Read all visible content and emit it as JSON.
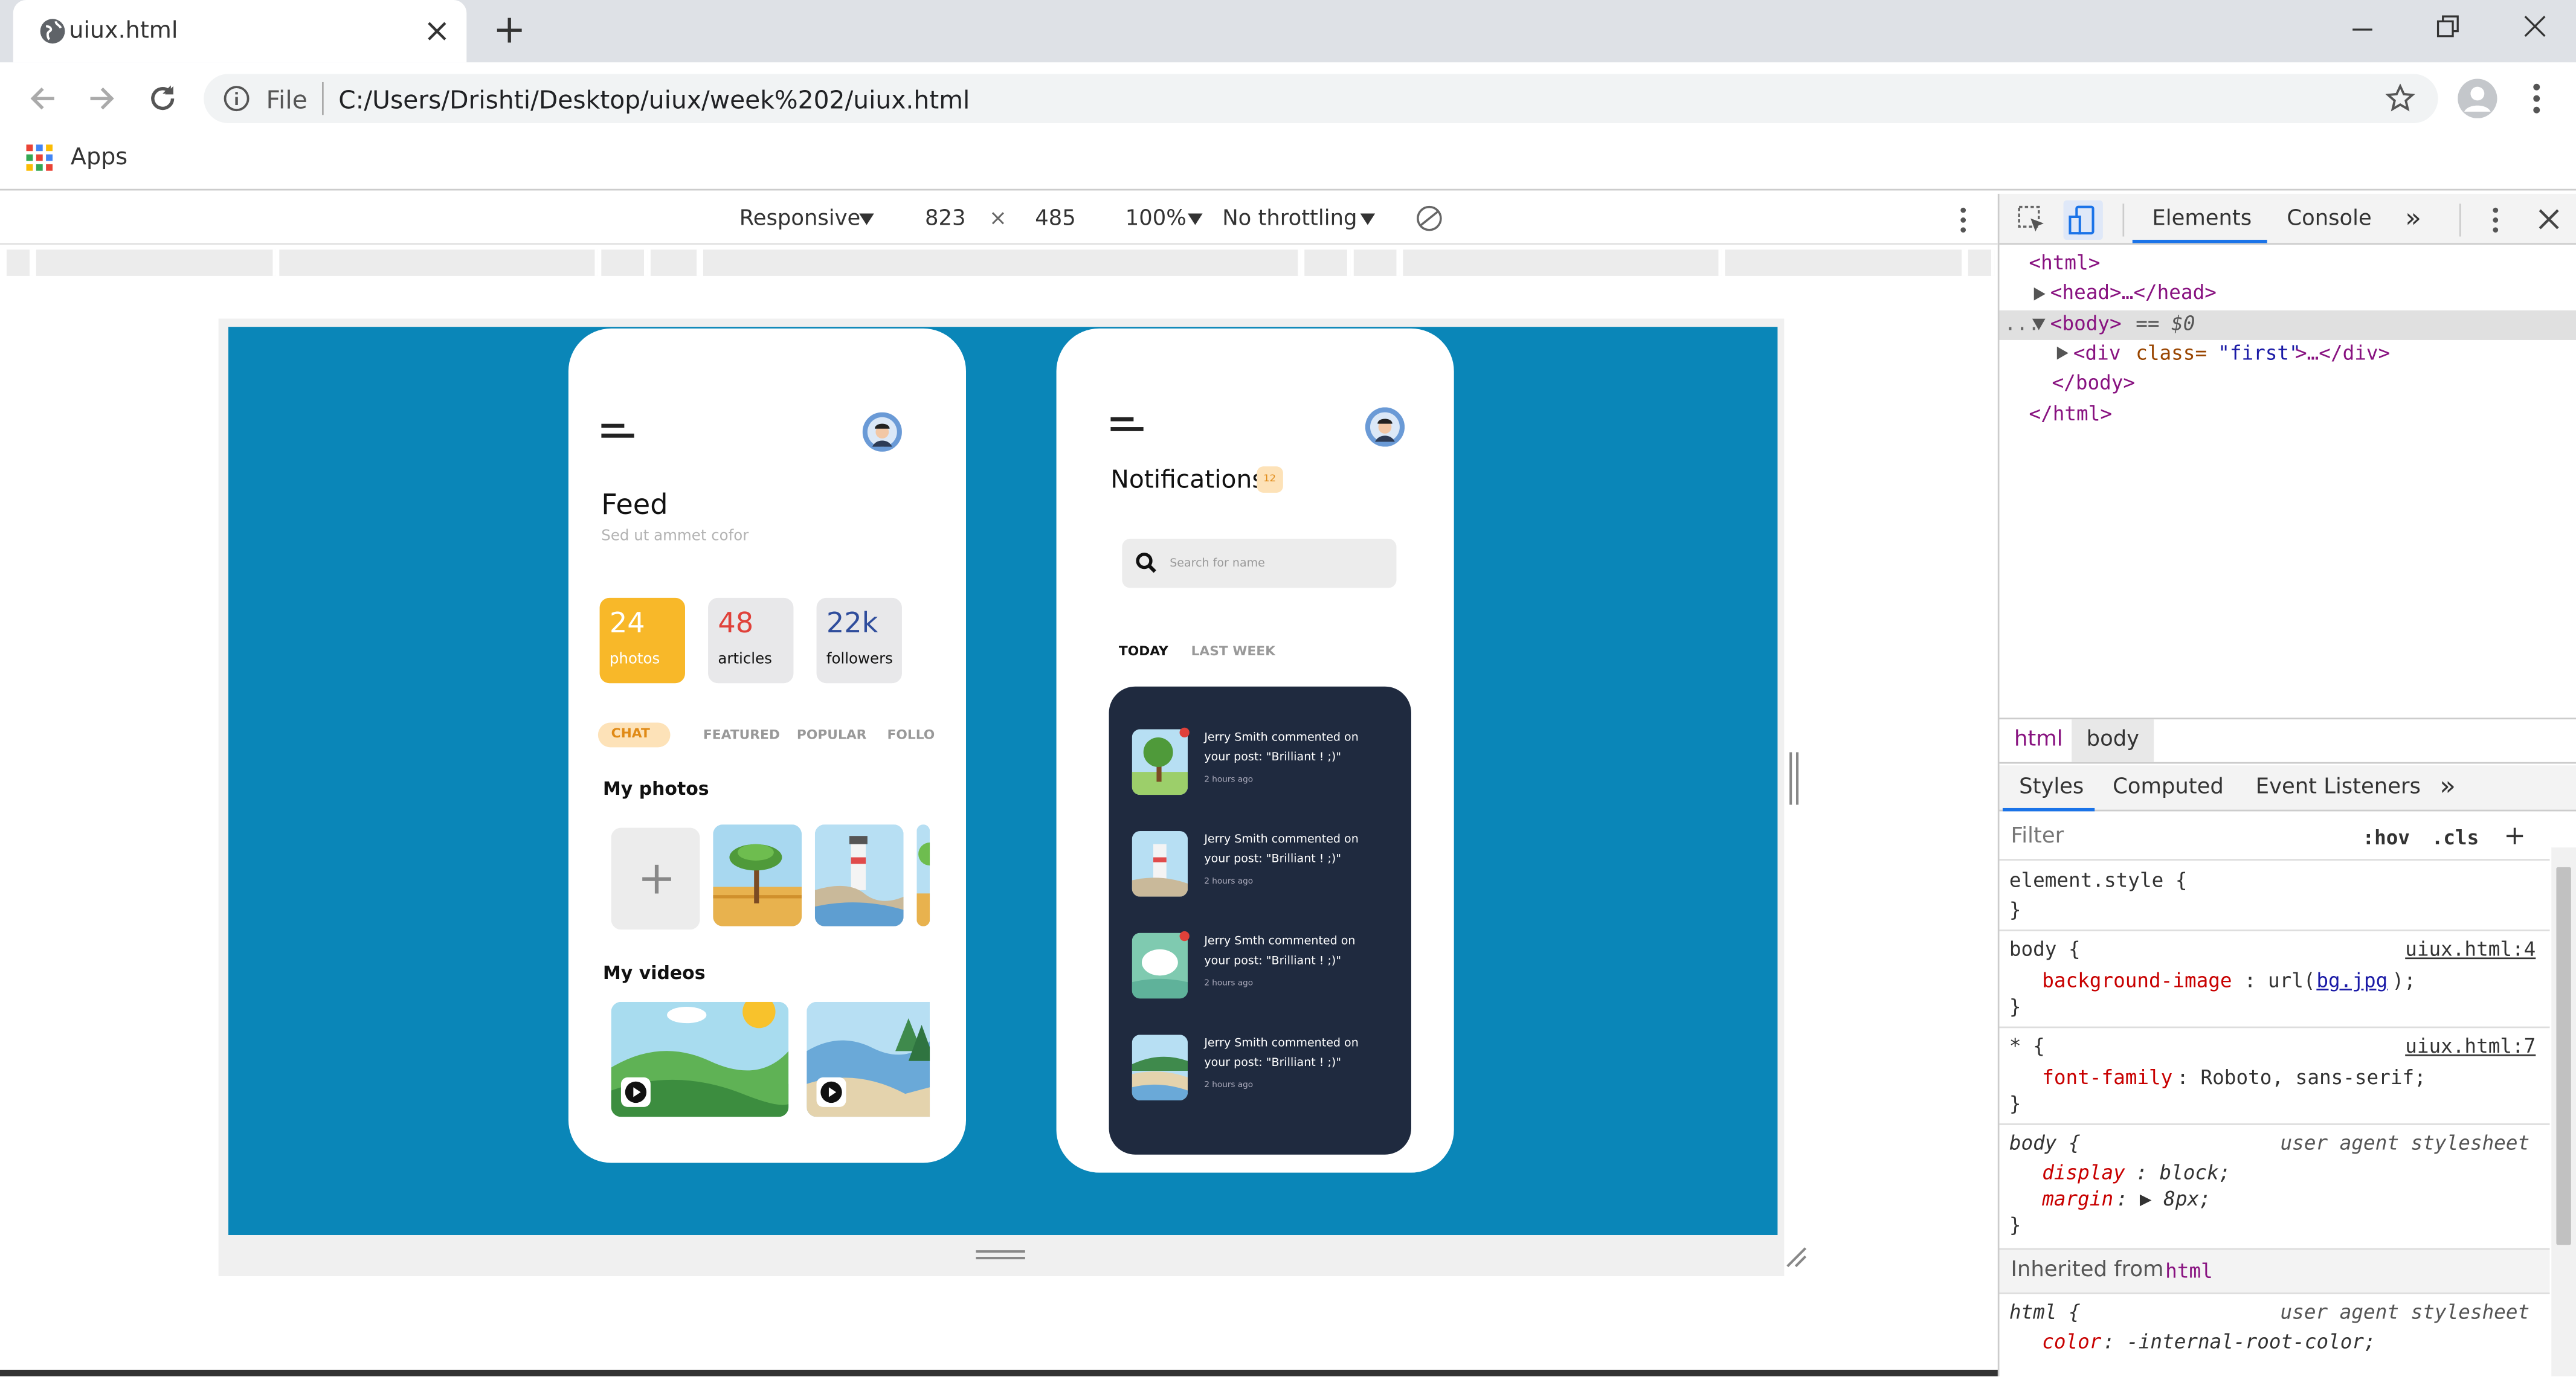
{
  "browser": {
    "tab_title": "uiux.html",
    "new_tab": "+",
    "url_label": "File",
    "url": "C:/Users/Drishti/Desktop/uiux/week%202/uiux.html",
    "bookmarks_apps": "Apps",
    "window_controls": [
      "minimize-icon",
      "restore-icon",
      "close-icon"
    ]
  },
  "device_toolbar": {
    "mode": "Responsive",
    "width": "823",
    "times": "×",
    "height": "485",
    "zoom": "100%",
    "throttling": "No throttling"
  },
  "feed_phone": {
    "title": "Feed",
    "subtitle": "Sed ut ammet cofor",
    "stats": [
      {
        "value": "24",
        "label": "photos",
        "color": "#f8b829"
      },
      {
        "value": "48",
        "label": "articles",
        "color": "#e8e8ea"
      },
      {
        "value": "22k",
        "label": "followers",
        "color": "#e8e8ea"
      }
    ],
    "tabs": [
      "CHAT",
      "FEATURED",
      "POPULAR",
      "FOLLO"
    ],
    "photos_heading": "My photos",
    "add_symbol": "+",
    "videos_heading": "My videos"
  },
  "notif_phone": {
    "title": "Notifications",
    "badge": "12",
    "search_placeholder": "Search for name",
    "tabs": [
      "TODAY",
      "LAST WEEK"
    ],
    "items": [
      {
        "line1": "Jerry Smith commented on",
        "line2": "your post: \"Brilliant ! ;)\"",
        "time": "2 hours ago"
      },
      {
        "line1": "Jerry Smith commented on",
        "line2": "your post: \"Brilliant ! ;)\"",
        "time": "2 hours ago"
      },
      {
        "line1": "Jerry Smth commented on",
        "line2": "your post: \"Brilliant ! ;)\"",
        "time": "2 hours ago"
      },
      {
        "line1": "Jerry Smith commented on",
        "line2": "your post: \"Brilliant ! ;)\"",
        "time": "2 hours ago"
      }
    ]
  },
  "devtools": {
    "tabs": [
      "Elements",
      "Console"
    ],
    "more": "»",
    "dom": {
      "html_open": "<html>",
      "head": "<head>…</head>",
      "body_open": "<body>",
      "body_eq": "== $0",
      "div_tag": "<div ",
      "div_attr": "class=",
      "div_val": "\"first\"",
      "div_rest": ">…</div>",
      "body_close": "</body>",
      "html_close": "</html>",
      "ellipsis": "..."
    },
    "breadcrumb": [
      "html",
      "body"
    ],
    "styles_tabs": [
      "Styles",
      "Computed",
      "Event Listeners"
    ],
    "filter_placeholder": "Filter",
    "hov": ":hov",
    "cls": ".cls",
    "plus": "+",
    "rules": {
      "element_style": "element.style {",
      "close": "}",
      "body1_sel": "body {",
      "body1_src": "uiux.html:4",
      "body1_prop": "background-image",
      "body1_pre": ": url(",
      "body1_link": "bg.jpg",
      "body1_post": ");",
      "star_sel": "* {",
      "star_src": "uiux.html:7",
      "star_prop": "font-family",
      "star_val": ": Roboto, sans-serif;",
      "body2_sel": "body {",
      "body2_src": "user agent stylesheet",
      "body2_p1": "display",
      "body2_v1": ": block;",
      "body2_p2": "margin",
      "body2_v2": ": ▶ 8px;",
      "inherited": "Inherited from",
      "inherited_tag": "html",
      "html_sel": "html {",
      "html_src": "user agent stylesheet",
      "html_prop": "color",
      "html_val": ": -internal-root-color;"
    }
  }
}
